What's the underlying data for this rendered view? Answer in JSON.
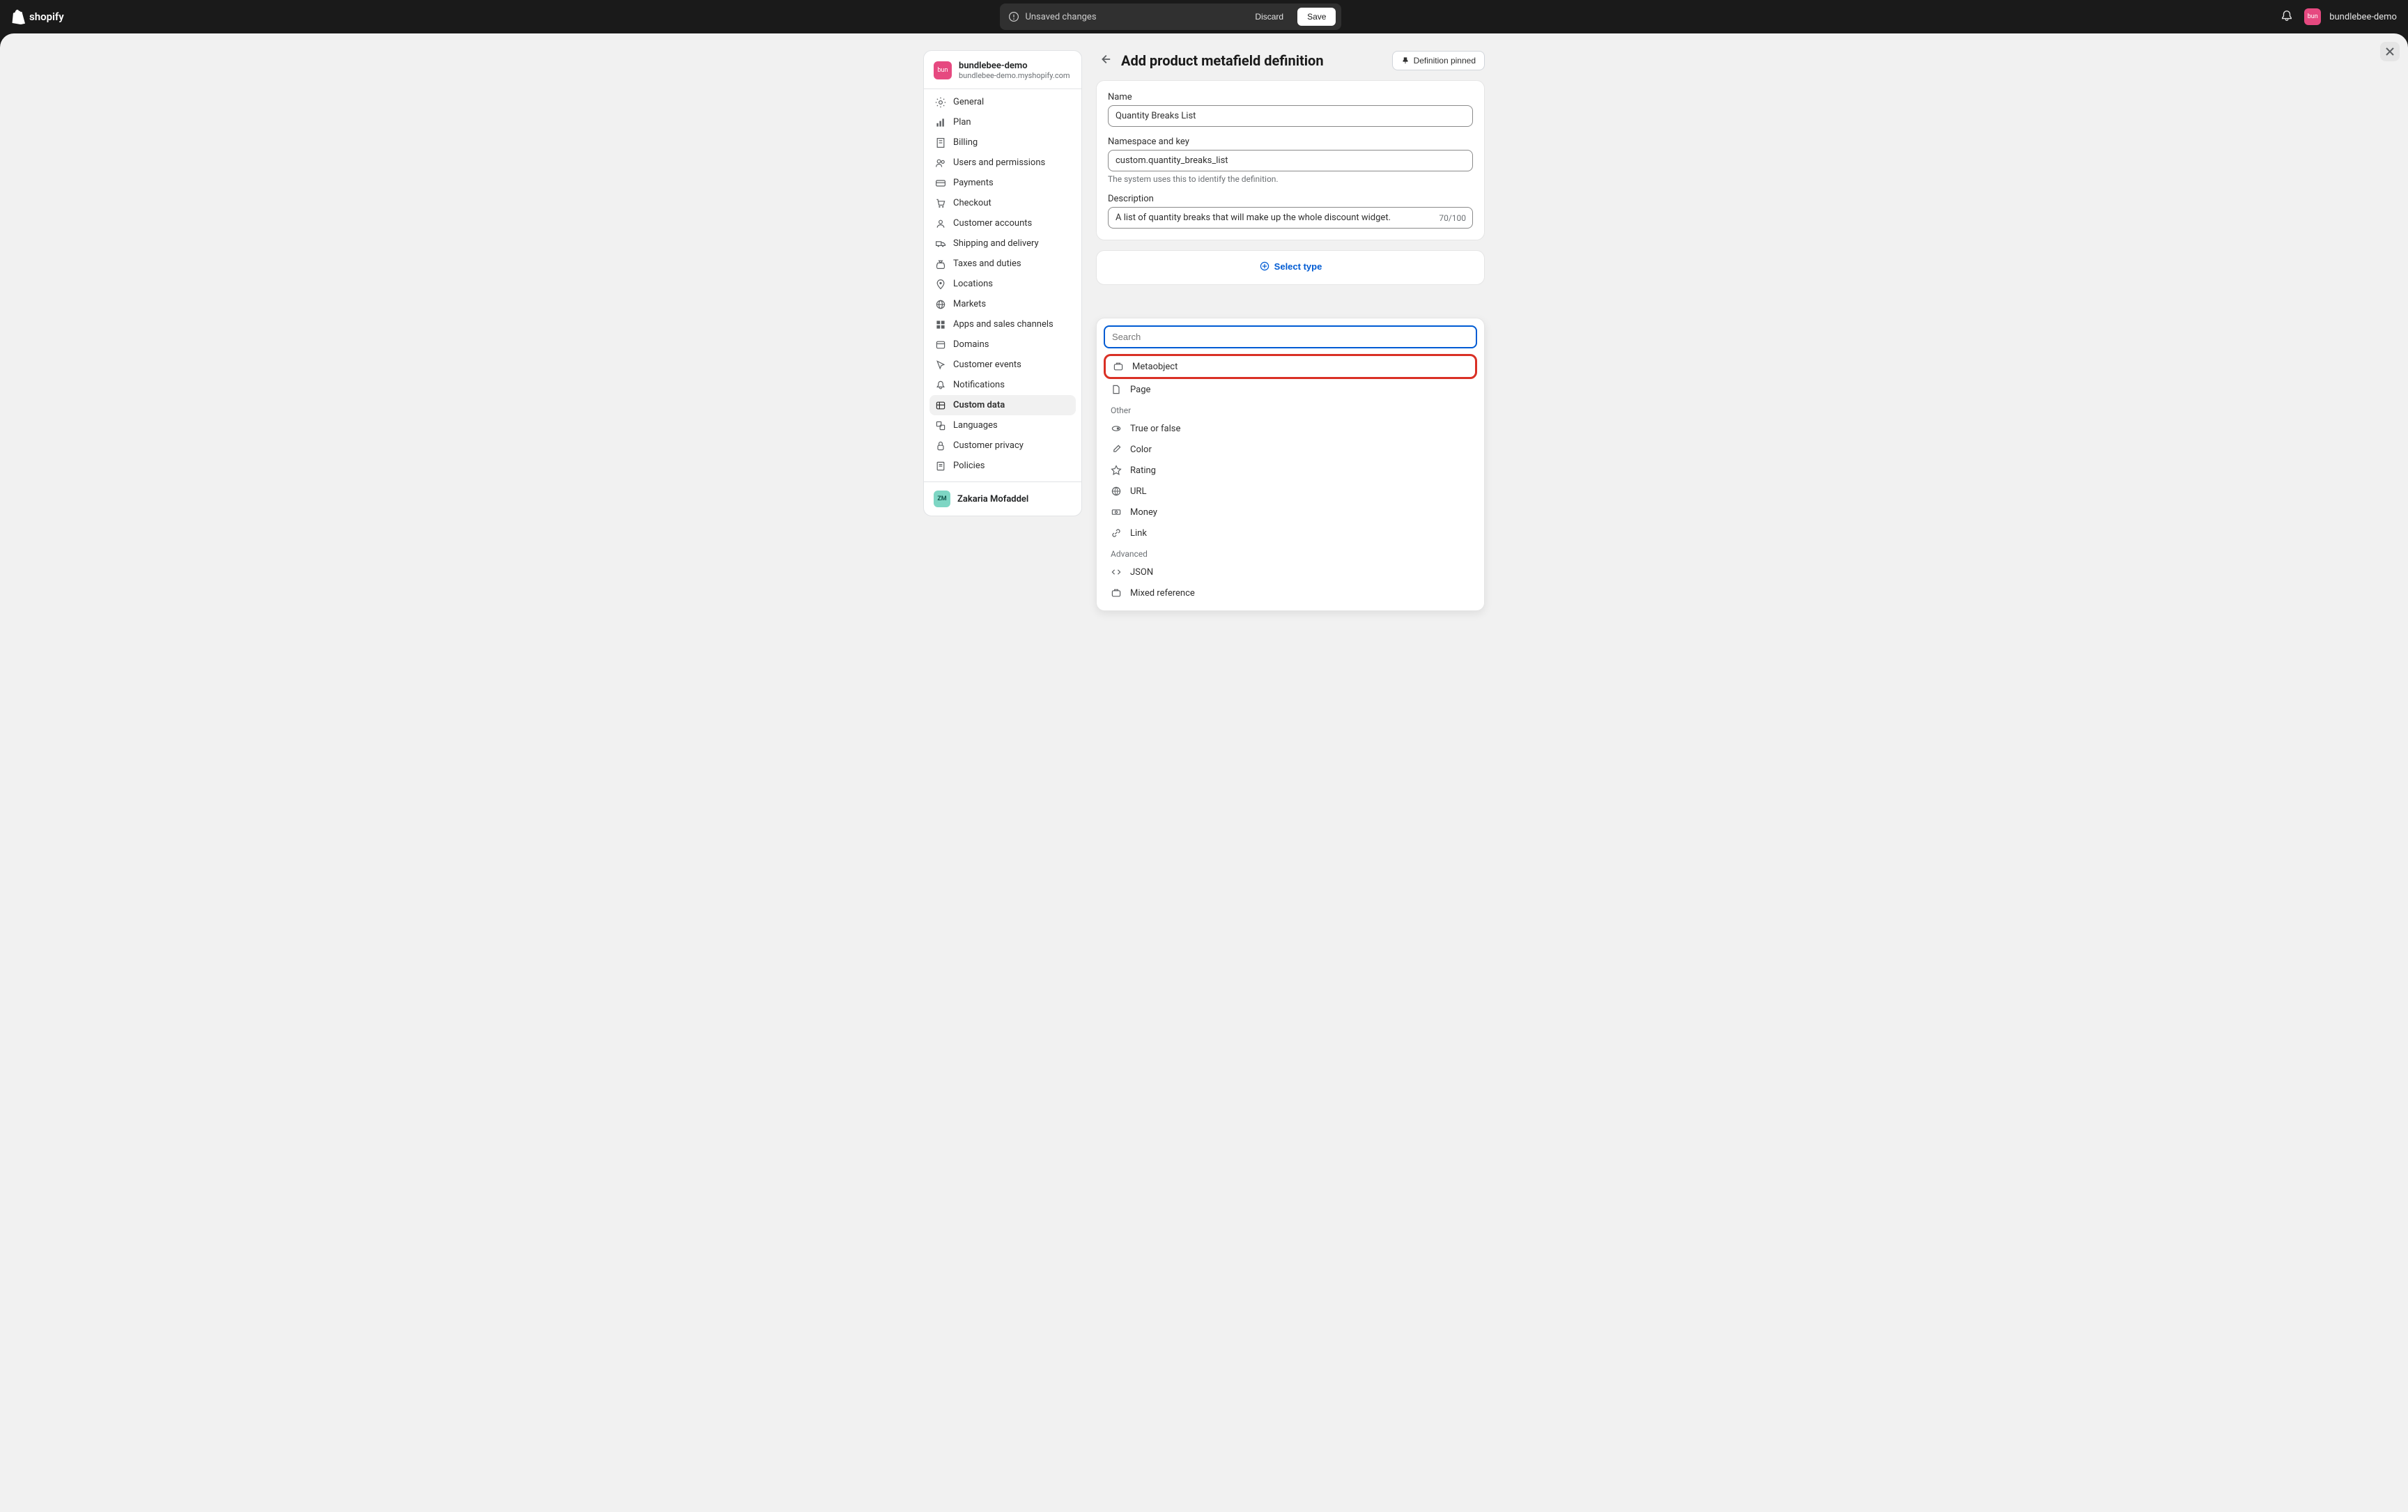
{
  "topbar": {
    "brand": "shopify",
    "unsaved": "Unsaved changes",
    "discard": "Discard",
    "save": "Save",
    "store": "bundlebee-demo",
    "avatar_text": "bun"
  },
  "sidebar": {
    "store_name": "bundlebee-demo",
    "store_url": "bundlebee-demo.myshopify.com",
    "avatar_text": "bun",
    "items": [
      "General",
      "Plan",
      "Billing",
      "Users and permissions",
      "Payments",
      "Checkout",
      "Customer accounts",
      "Shipping and delivery",
      "Taxes and duties",
      "Locations",
      "Markets",
      "Apps and sales channels",
      "Domains",
      "Customer events",
      "Notifications",
      "Custom data",
      "Languages",
      "Customer privacy",
      "Policies"
    ],
    "user_name": "Zakaria Mofaddel",
    "user_initials": "ZM"
  },
  "page": {
    "title": "Add product metafield definition",
    "pin_label": "Definition pinned"
  },
  "form": {
    "name_label": "Name",
    "name_value": "Quantity Breaks List",
    "ns_label": "Namespace and key",
    "ns_value": "custom.quantity_breaks_list",
    "ns_hint": "The system uses this to identify the definition.",
    "desc_label": "Description",
    "desc_value": "A list of quantity breaks that will make up the whole discount widget.",
    "desc_counter": "70/100",
    "select_type": "Select type"
  },
  "dropdown": {
    "search_placeholder": "Search",
    "options": [
      "Metaobject",
      "Page"
    ],
    "group_other": "Other",
    "options_other": [
      "True or false",
      "Color",
      "Rating",
      "URL",
      "Money",
      "Link"
    ],
    "group_advanced": "Advanced",
    "options_advanced": [
      "JSON",
      "Mixed reference"
    ]
  }
}
